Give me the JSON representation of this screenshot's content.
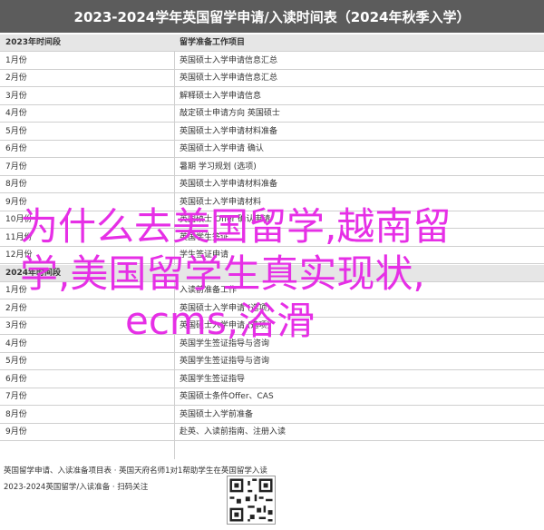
{
  "title": "2023-2024学年英国留学申请/入读时间表（2024年秋季入学）",
  "table": {
    "header": {
      "period": "2023年时间段",
      "task": "留学准备工作项目"
    },
    "rows_2023": [
      {
        "period": "1月份",
        "task": "英国硕士入学申请信息汇总"
      },
      {
        "period": "2月份",
        "task": "英国硕士入学申请信息汇总"
      },
      {
        "period": "3月份",
        "task": "解释硕士入学申请信息"
      },
      {
        "period": "4月份",
        "task": "敲定硕士申请方向 英国硕士"
      },
      {
        "period": "5月份",
        "task": "英国硕士入学申请材料准备"
      },
      {
        "period": "6月份",
        "task": "英国硕士入学申请 确认"
      },
      {
        "period": "7月份",
        "task": "暑期 学习规划 (选项)"
      },
      {
        "period": "8月份",
        "task": "英国硕士入学申请材料准备"
      },
      {
        "period": "9月份",
        "task": "英国硕士入学申请材料"
      },
      {
        "period": "10月份",
        "task": "英国硕士 Offer 确认申请"
      },
      {
        "period": "11月份",
        "task": "英国学生签证"
      },
      {
        "period": "12月份",
        "task": "学生签证申请"
      }
    ],
    "section_2024": "2024年时间段",
    "rows_2024": [
      {
        "period": "1月份",
        "task": "入读前准备工作"
      },
      {
        "period": "2月份",
        "task": "英国硕士入学申请 (选项)"
      },
      {
        "period": "3月份",
        "task": "英国硕士入学申请 (选项)"
      },
      {
        "period": "4月份",
        "task": "英国学生签证指导与咨询"
      },
      {
        "period": "5月份",
        "task": "英国学生签证指导与咨询"
      },
      {
        "period": "6月份",
        "task": "英国学生签证指导"
      },
      {
        "period": "7月份",
        "task": "英国硕士条件Offer、CAS"
      },
      {
        "period": "8月份",
        "task": "英国硕士入学前准备"
      },
      {
        "period": "9月份",
        "task": "赴英、入读前指南、注册入读"
      }
    ]
  },
  "overlay": {
    "line1": "为什么去美国留学,越南留",
    "line2": "学,美国留学生真实现状,",
    "line3": "ecms,浴滑"
  },
  "footer": {
    "line1": "英国留学申请、入读准备项目表 · 英国天府名师1对1帮助学生在英国留学入读",
    "line2": "2023-2024英国留学/入读准备 · 扫码关注"
  },
  "colors": {
    "title_bg": "#5c5c5c",
    "overlay": "#e62fe6",
    "header_bg": "#e6e6e6"
  }
}
